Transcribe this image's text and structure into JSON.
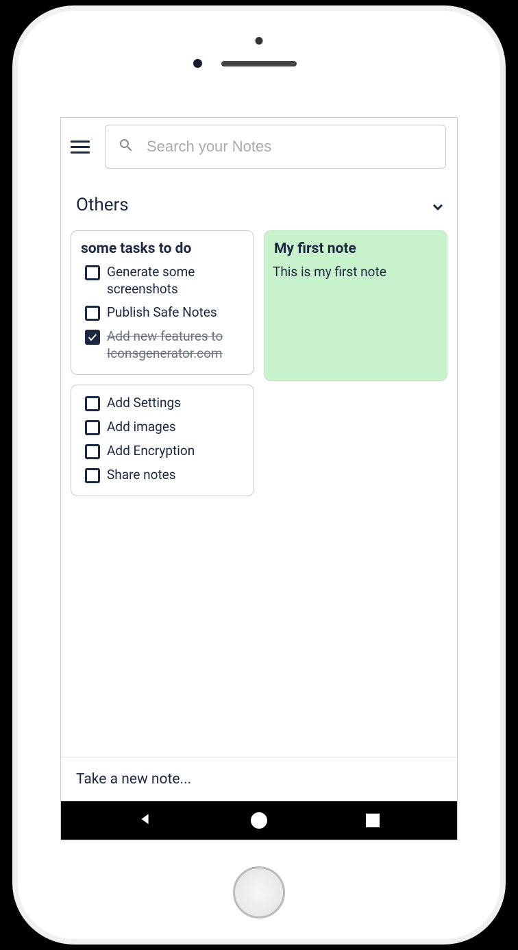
{
  "search": {
    "placeholder": "Search your Notes"
  },
  "section": {
    "title": "Others"
  },
  "notes": [
    {
      "title": "some tasks to do",
      "tasks": [
        {
          "label": "Generate some screenshots",
          "done": false
        },
        {
          "label": "Publish Safe Notes",
          "done": false
        },
        {
          "label": "Add new features to Iconsgenerator.com",
          "done": true
        }
      ]
    },
    {
      "title": "My first note",
      "body": "This is my first note"
    },
    {
      "tasks": [
        {
          "label": "Add Settings",
          "done": false
        },
        {
          "label": "Add images",
          "done": false
        },
        {
          "label": "Add Encryption",
          "done": false
        },
        {
          "label": "Share notes",
          "done": false
        }
      ]
    }
  ],
  "newNote": {
    "placeholder": "Take a new note..."
  }
}
